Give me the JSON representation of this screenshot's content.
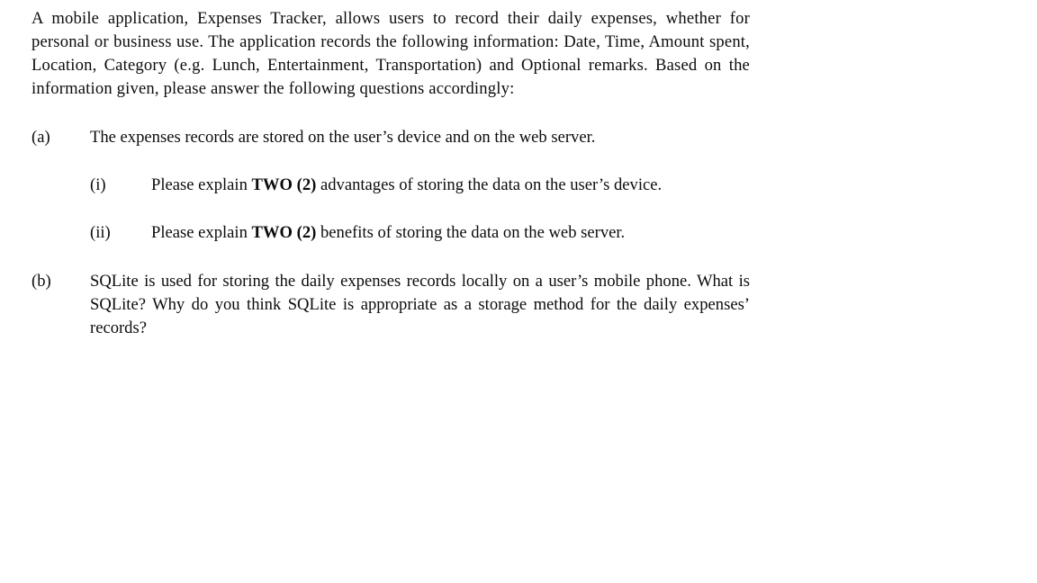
{
  "document": {
    "intro": "A mobile application, Expenses Tracker, allows users to record their daily expenses, whether for personal or business use. The application records the following information: Date, Time, Amount spent, Location, Category (e.g. Lunch, Entertainment, Transportation) and Optional remarks. Based on the information given, please answer the following questions accordingly:",
    "questions": [
      {
        "label": "(a)",
        "text": "The expenses records are stored on the user’s device and on the web server.",
        "subquestions": [
          {
            "label": "(i)",
            "text_before_emphasis": "Please explain ",
            "emphasis": "TWO (2)",
            "text_after_emphasis": " advantages of storing the data on the user’s device."
          },
          {
            "label": "(ii)",
            "text_before_emphasis": "Please explain ",
            "emphasis": "TWO (2)",
            "text_after_emphasis": " benefits of storing the data on the web server."
          }
        ]
      },
      {
        "label": "(b)",
        "text": "SQLite is used for storing the daily expenses records locally on a user’s mobile phone. What is SQLite? Why do you think SQLite is appropriate as a storage method for the daily expenses’ records?",
        "subquestions": []
      }
    ]
  },
  "style": {
    "text_color": "#0c0c0c",
    "background_color": "#ffffff"
  }
}
